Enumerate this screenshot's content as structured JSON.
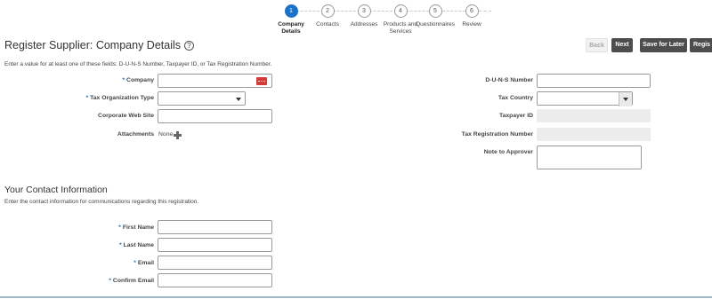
{
  "train": {
    "stops": [
      {
        "num": "1",
        "label": "Company\nDetails",
        "active": true
      },
      {
        "num": "2",
        "label": "Contacts",
        "active": false
      },
      {
        "num": "3",
        "label": "Addresses",
        "active": false
      },
      {
        "num": "4",
        "label": "Products and\nServices",
        "active": false
      },
      {
        "num": "5",
        "label": "Questionnaires",
        "active": false
      },
      {
        "num": "6",
        "label": "Review",
        "active": false
      }
    ]
  },
  "header": {
    "title": "Register Supplier: Company Details",
    "help_glyph": "?",
    "back_label": "Back",
    "next_label": "Next",
    "save_later_label": "Save for Later",
    "register_label": "Regis"
  },
  "company": {
    "instruction": "Enter a value for at least one of these fields: D-U-N-S Number, Taxpayer ID, or Tax Registration Number.",
    "company_label": "Company",
    "tax_org_type_label": "Tax Organization Type",
    "website_label": "Corporate Web Site",
    "attachments_label": "Attachments",
    "attachments_value": "None",
    "duns_label": "D-U-N-S Number",
    "tax_country_label": "Tax Country",
    "taxpayer_id_label": "Taxpayer ID",
    "tax_reg_label": "Tax Registration Number",
    "note_label": "Note to Approver",
    "required_mark": "*"
  },
  "contact": {
    "title": "Your Contact Information",
    "instruction": "Enter the contact information for communications regarding this registration.",
    "first_name_label": "First Name",
    "last_name_label": "Last Name",
    "email_label": "Email",
    "confirm_email_label": "Confirm Email",
    "required_mark": "*"
  },
  "colors": {
    "accent": "#1a73c8",
    "required": "#1a6fb8",
    "button_dark": "#4d4d4d"
  }
}
